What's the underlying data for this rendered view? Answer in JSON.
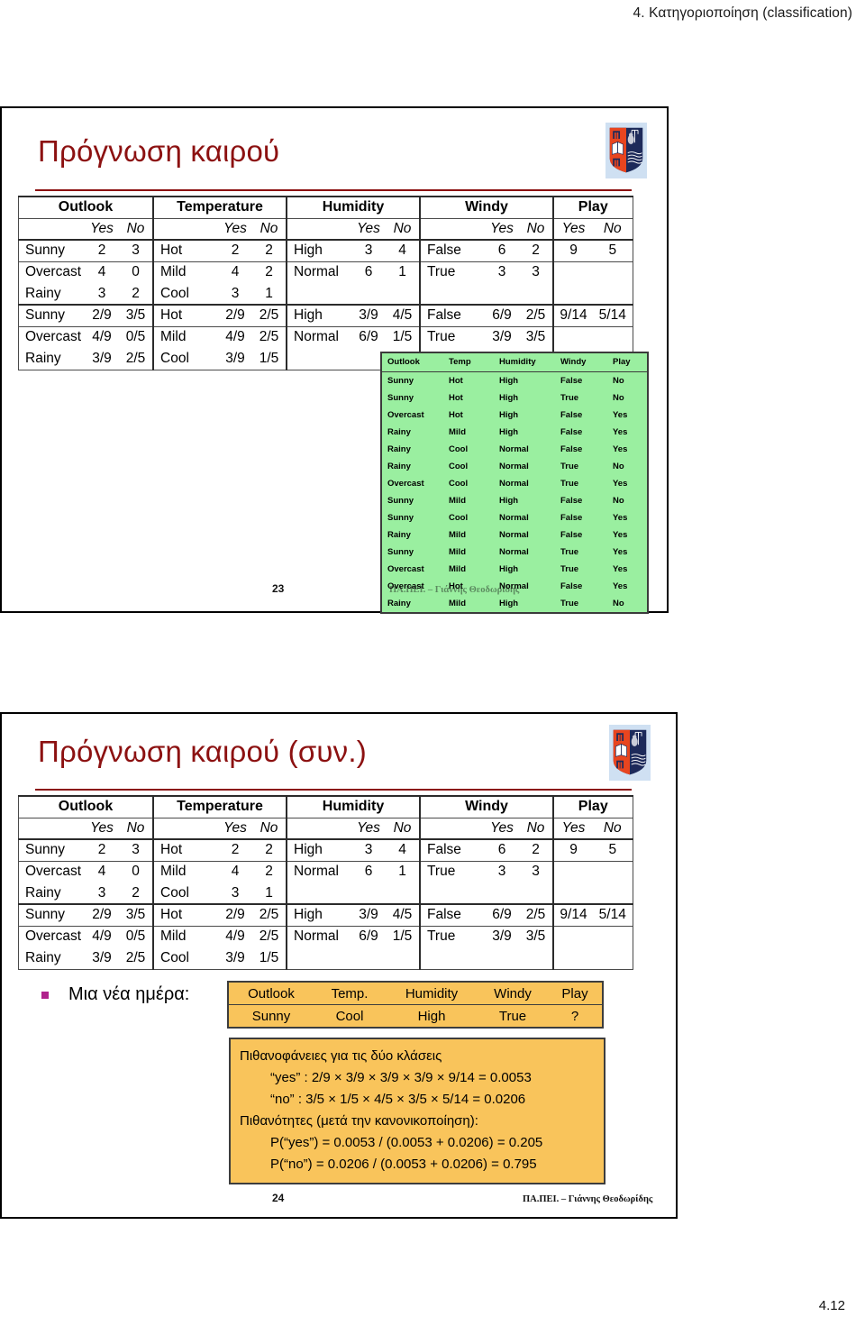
{
  "document": {
    "running_header": "4. Κατηγοριοποίηση (classification)",
    "page_number": "4.12"
  },
  "slide23": {
    "title": "Πρόγνωση καιρού",
    "slide_number": "23",
    "footer": "ΠΑ.ΠΕΙ. – Γιάννης Θεοδωρίδης",
    "logo_name": "university-of-piraeus-crest"
  },
  "slide24": {
    "title": "Πρόγνωση καιρού (συν.)",
    "slide_number": "24",
    "footer": "ΠΑ.ΠΕΙ. – Γιάννης Θεοδωρίδης",
    "logo_name": "university-of-piraeus-crest",
    "bullet_text": "Μια νέα ημέρα:"
  },
  "count_table": {
    "group_headers": [
      "Outlook",
      "Temperature",
      "Humidity",
      "Windy",
      "Play"
    ],
    "yes_no": {
      "yes": "Yes",
      "no": "No"
    },
    "counts": {
      "outlook": [
        [
          "Sunny",
          "2",
          "3"
        ],
        [
          "Overcast",
          "4",
          "0"
        ],
        [
          "Rainy",
          "3",
          "2"
        ]
      ],
      "temperature": [
        [
          "Hot",
          "2",
          "2"
        ],
        [
          "Mild",
          "4",
          "2"
        ],
        [
          "Cool",
          "3",
          "1"
        ]
      ],
      "humidity": [
        [
          "High",
          "3",
          "4"
        ],
        [
          "Normal",
          "6",
          "1"
        ],
        [
          "",
          "",
          ""
        ]
      ],
      "windy": [
        [
          "False",
          "6",
          "2"
        ],
        [
          "True",
          "3",
          "3"
        ],
        [
          "",
          "",
          ""
        ]
      ],
      "play": [
        [
          "9",
          "5"
        ],
        [
          "",
          ""
        ],
        [
          "",
          ""
        ]
      ]
    },
    "fractions": {
      "outlook": [
        [
          "Sunny",
          "2/9",
          "3/5"
        ],
        [
          "Overcast",
          "4/9",
          "0/5"
        ],
        [
          "Rainy",
          "3/9",
          "2/5"
        ]
      ],
      "temperature": [
        [
          "Hot",
          "2/9",
          "2/5"
        ],
        [
          "Mild",
          "4/9",
          "2/5"
        ],
        [
          "Cool",
          "3/9",
          "1/5"
        ]
      ],
      "humidity": [
        [
          "High",
          "3/9",
          "4/5"
        ],
        [
          "Normal",
          "6/9",
          "1/5"
        ],
        [
          "",
          "",
          ""
        ]
      ],
      "windy": [
        [
          "False",
          "6/9",
          "2/5"
        ],
        [
          "True",
          "3/9",
          "3/5"
        ],
        [
          "",
          "",
          ""
        ]
      ],
      "play": [
        [
          "9/14",
          "5/14"
        ],
        [
          "",
          ""
        ],
        [
          "",
          ""
        ]
      ]
    }
  },
  "green_table": {
    "headers": [
      "Outlook",
      "Temp",
      "Humidity",
      "Windy",
      "Play"
    ],
    "rows": [
      [
        "Sunny",
        "Hot",
        "High",
        "False",
        "No"
      ],
      [
        "Sunny",
        "Hot",
        "High",
        "True",
        "No"
      ],
      [
        "Overcast",
        "Hot",
        "High",
        "False",
        "Yes"
      ],
      [
        "Rainy",
        "Mild",
        "High",
        "False",
        "Yes"
      ],
      [
        "Rainy",
        "Cool",
        "Normal",
        "False",
        "Yes"
      ],
      [
        "Rainy",
        "Cool",
        "Normal",
        "True",
        "No"
      ],
      [
        "Overcast",
        "Cool",
        "Normal",
        "True",
        "Yes"
      ],
      [
        "Sunny",
        "Mild",
        "High",
        "False",
        "No"
      ],
      [
        "Sunny",
        "Cool",
        "Normal",
        "False",
        "Yes"
      ],
      [
        "Rainy",
        "Mild",
        "Normal",
        "False",
        "Yes"
      ],
      [
        "Sunny",
        "Mild",
        "Normal",
        "True",
        "Yes"
      ],
      [
        "Overcast",
        "Mild",
        "High",
        "True",
        "Yes"
      ],
      [
        "Overcast",
        "Hot",
        "Normal",
        "False",
        "Yes"
      ],
      [
        "Rainy",
        "Mild",
        "High",
        "True",
        "No"
      ]
    ]
  },
  "new_day_table": {
    "headers": [
      "Outlook",
      "Temp.",
      "Humidity",
      "Windy",
      "Play"
    ],
    "values": [
      "Sunny",
      "Cool",
      "High",
      "True",
      "?"
    ]
  },
  "calc_box": {
    "line1": "Πιθανοφάνειες για τις δύο κλάσεις",
    "line2": "“yes” : 2/9 × 3/9 × 3/9 ×  3/9 × 9/14 = 0.0053",
    "line3": "“no” : 3/5 × 1/5 × 4/5 × 3/5 × 5/14 = 0.0206",
    "line4": "Πιθανότητες (μετά την κανονικοποίηση):",
    "line5": "P(“yes”) = 0.0053 / (0.0053 + 0.0206) = 0.205",
    "line6": "P(“no”) = 0.0206 / (0.0053 + 0.0206) = 0.795"
  },
  "colors": {
    "title_red": "#8c1111",
    "green_fill": "#9aefa0",
    "orange_fill": "#f9c45b",
    "bullet_magenta": "#b0228c"
  }
}
